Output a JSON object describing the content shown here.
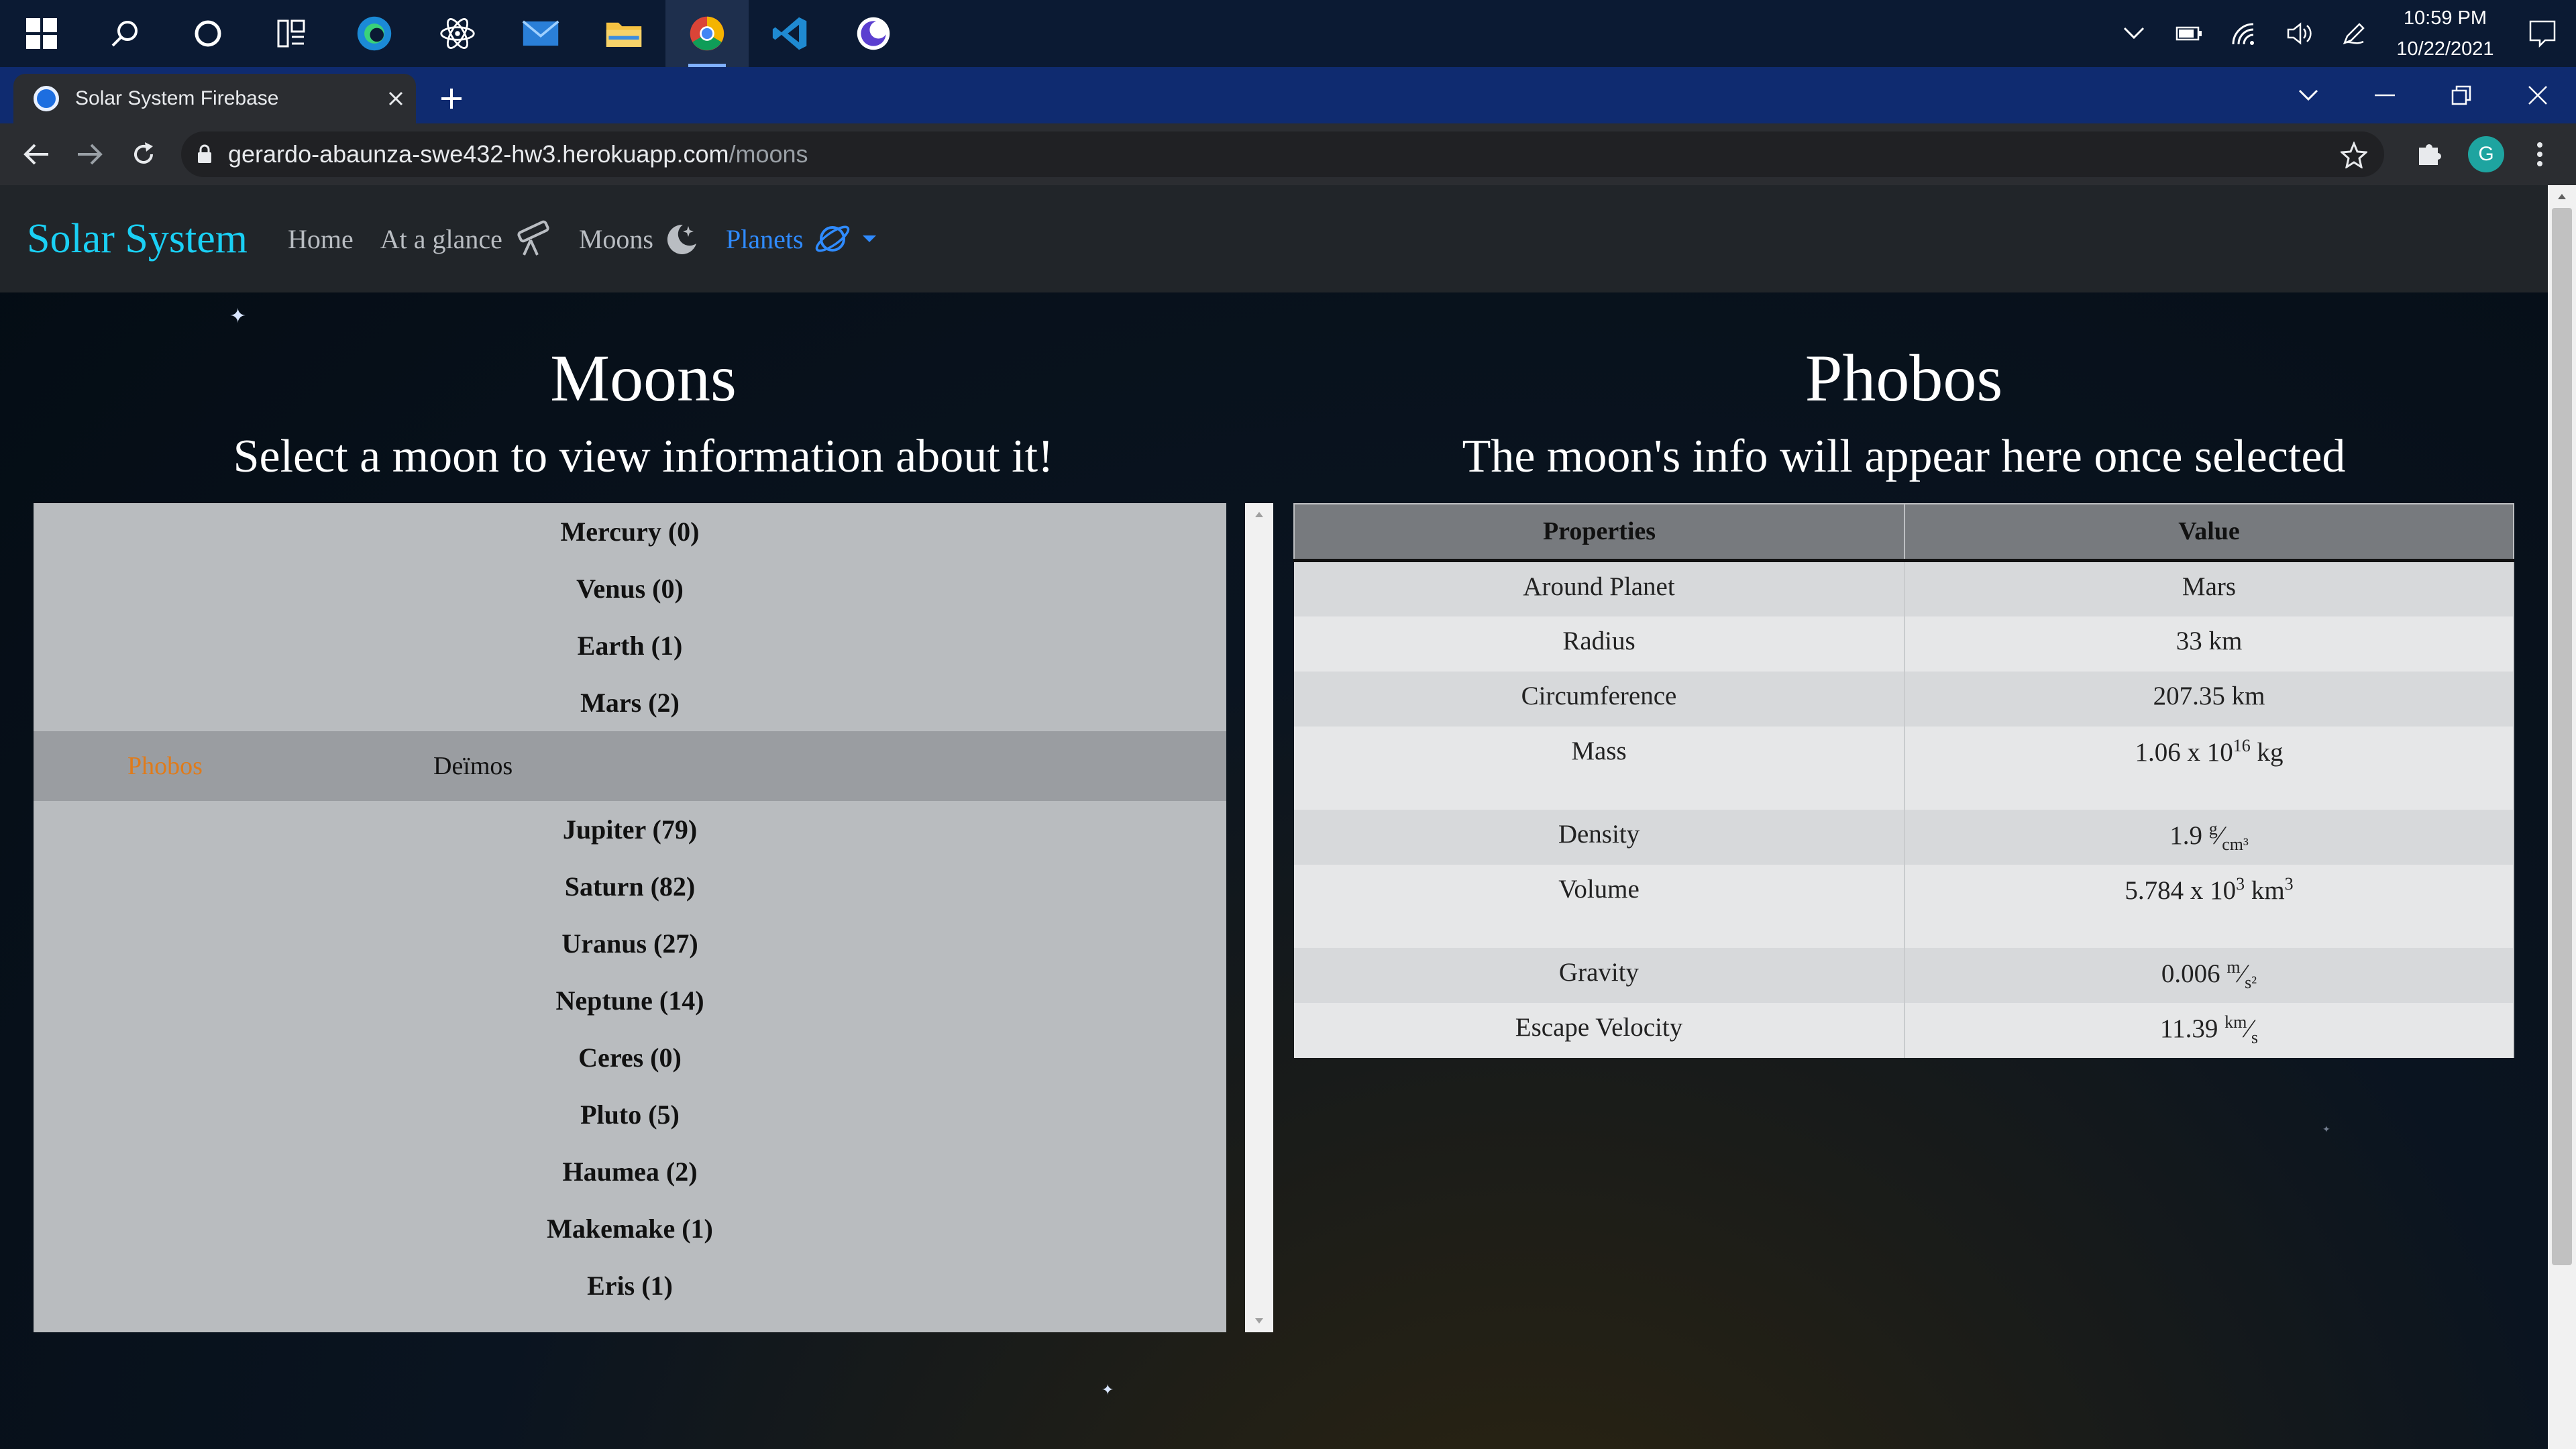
{
  "taskbar": {
    "time": "10:59 PM",
    "date": "10/22/2021"
  },
  "browser": {
    "tab_title": "Solar System Firebase",
    "url_host": "gerardo-abaunza-swe432-hw3.herokuapp.com",
    "url_path": "/moons",
    "profile_initial": "G"
  },
  "nav": {
    "brand": "Solar System",
    "links": [
      "Home",
      "At a glance",
      "Moons",
      "Planets"
    ]
  },
  "left": {
    "title": "Moons",
    "subtitle": "Select a moon to view information about it!"
  },
  "right": {
    "title": "Phobos",
    "subtitle": "The moon's info will appear here once selected"
  },
  "planets_before": [
    "Mercury (0)",
    "Venus (0)",
    "Earth (1)",
    "Mars (2)"
  ],
  "mars_moons": [
    "Phobos",
    "Deïmos"
  ],
  "selected_moon": "Phobos",
  "planets_after": [
    "Jupiter (79)",
    "Saturn (82)",
    "Uranus (27)",
    "Neptune (14)",
    "Ceres (0)",
    "Pluto (5)",
    "Haumea (2)",
    "Makemake (1)",
    "Eris (1)"
  ],
  "table": {
    "headers": [
      "Properties",
      "Value"
    ],
    "rows": [
      {
        "label": "Around Planet",
        "value": "Mars"
      },
      {
        "label": "Radius",
        "value": "33 km"
      },
      {
        "label": "Circumference",
        "value": "207.35 km"
      },
      {
        "label": "Mass",
        "value_main": "1.06 x 10",
        "value_sup": "16",
        "value_unit": " kg"
      },
      {
        "label": "Density",
        "value_main": "1.9 ",
        "value_sup": "g",
        "value_sep": "⁄",
        "value_sub": "cm³"
      },
      {
        "label": "Volume",
        "value_main": "5.784 x 10",
        "value_sup": "3",
        "value_unit": " km",
        "value_sup2": "3"
      },
      {
        "label": "Gravity",
        "value_main": "0.006 ",
        "value_sup": "m",
        "value_sep": "⁄",
        "value_sub": "s²"
      },
      {
        "label": "Escape Velocity",
        "value_main": "11.39 ",
        "value_sup": "km",
        "value_sep": "⁄",
        "value_sub": "s"
      }
    ]
  }
}
